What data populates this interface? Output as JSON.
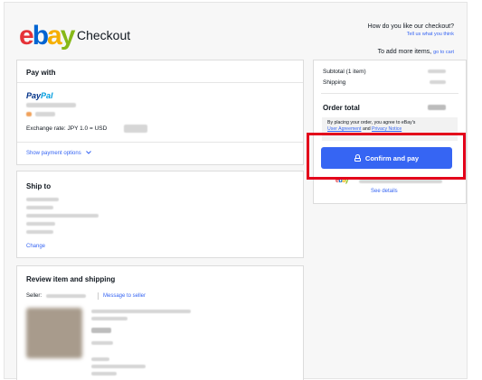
{
  "header": {
    "logo_letters": [
      "e",
      "b",
      "a",
      "y"
    ],
    "logo_colors": [
      "#e53238",
      "#0064d2",
      "#f5af02",
      "#86b817"
    ],
    "title": "Checkout",
    "feedback_question": "How do you like our checkout?",
    "feedback_link": "Tell us what you think",
    "add_more_text": "To add more items,",
    "add_more_link": "go to cart"
  },
  "pay_with": {
    "title": "Pay with",
    "paypal_pay": "Pay",
    "paypal_pal": "Pal",
    "exchange_rate": "Exchange rate: JPY 1.0 = USD",
    "show_options": "Show payment options"
  },
  "ship_to": {
    "title": "Ship to",
    "change": "Change"
  },
  "review": {
    "title": "Review item and shipping",
    "seller_label": "Seller:",
    "message_seller": "Message to seller"
  },
  "summary": {
    "subtotal_label": "Subtotal (1 item)",
    "shipping_label": "Shipping",
    "order_total_label": "Order total",
    "notice_text": "By placing your order, you agree to eBay's",
    "user_agreement": "User Agreement",
    "and_text": "and",
    "privacy_notice": "Privacy Notice",
    "confirm_button": "Confirm and pay",
    "see_details": "See details"
  },
  "colors": {
    "accent": "#3665f3",
    "highlight": "#e3001b"
  }
}
